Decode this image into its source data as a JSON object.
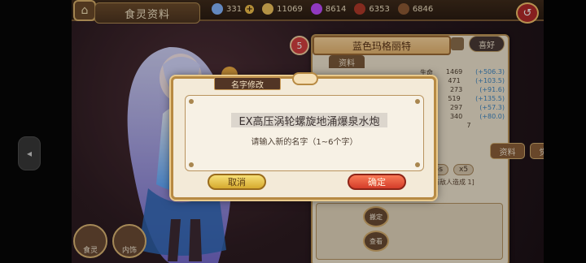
{
  "header": {
    "back_icon": "home-back-icon",
    "title": "食灵资料",
    "resources": [
      {
        "name": "gems",
        "value": "331",
        "color": "#84b6ff"
      },
      {
        "name": "coins",
        "value": "11069",
        "color": "#f1c35c"
      },
      {
        "name": "gift",
        "value": "8614",
        "color": "#c04cff"
      },
      {
        "name": "meat",
        "value": "6353",
        "color": "#b03a2a"
      },
      {
        "name": "stamina",
        "value": "6846",
        "color": "#8e5a35"
      }
    ]
  },
  "panel": {
    "level": "5",
    "character_name": "蓝色玛格丽特",
    "favorite_label": "喜好",
    "info_tab": "资料",
    "stats": [
      {
        "label": "生命",
        "value": "1469",
        "bonus": "(+506.3)"
      },
      {
        "label": "攻击",
        "value": "471",
        "bonus": "(+103.5)"
      },
      {
        "label": "防御",
        "value": "273",
        "bonus": "(+91.6)"
      },
      {
        "label": "命中",
        "value": "519",
        "bonus": "(+135.5)"
      },
      {
        "label": "闪避",
        "value": "297",
        "bonus": "(+57.3)"
      },
      {
        "label": "暴击",
        "value": "340",
        "bonus": "(+80.0)"
      },
      {
        "label": "暴伤",
        "value": "7",
        "bonus": ""
      }
    ],
    "detail_tabs": [
      "资料",
      "觉醒"
    ],
    "skill_chips": [
      "0.5s",
      "x5"
    ],
    "skill_text": "对所有敌人造成 1]"
  },
  "side_buttons": [
    "搬定",
    "查看"
  ],
  "bottom_tabs": [
    "食灵",
    "内饰"
  ],
  "dialog": {
    "title": "名字修改",
    "input_value": "EX高压涡轮螺旋地涌爆泉水炮",
    "hint": "请输入新的名字（1~6个字）",
    "cancel": "取消",
    "confirm": "确定"
  }
}
